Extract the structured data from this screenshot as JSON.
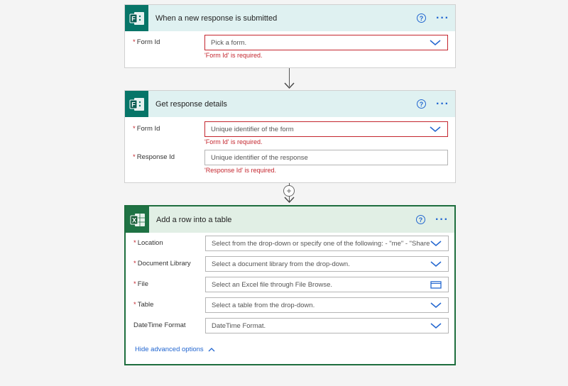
{
  "card1": {
    "title": "When a new response is submitted",
    "fields": [
      {
        "label": "Form Id",
        "required": true,
        "placeholder": "Pick a form.",
        "error": "'Form Id' is required."
      }
    ]
  },
  "card2": {
    "title": "Get response details",
    "fields": [
      {
        "label": "Form Id",
        "required": true,
        "placeholder": "Unique identifier of the form",
        "error": "'Form Id' is required."
      },
      {
        "label": "Response Id",
        "required": true,
        "placeholder": "Unique identifier of the response",
        "error": "'Response Id' is required."
      }
    ]
  },
  "card3": {
    "title": "Add a row into a table",
    "fields": [
      {
        "label": "Location",
        "required": true,
        "placeholder": "Select from the drop-down or specify one of the following: - \"me\" - \"SharePoint Site URL\""
      },
      {
        "label": "Document Library",
        "required": true,
        "placeholder": "Select a document library from the drop-down."
      },
      {
        "label": "File",
        "required": true,
        "placeholder": "Select an Excel file through File Browse."
      },
      {
        "label": "Table",
        "required": true,
        "placeholder": "Select a table from the drop-down."
      },
      {
        "label": "DateTime Format",
        "required": false,
        "placeholder": "DateTime Format."
      }
    ],
    "advanced_link": "Hide advanced options"
  },
  "required_mark": "*",
  "help_glyph": "?",
  "more_glyph": "···",
  "colors": {
    "forms_brand": "#077568",
    "excel_brand": "#1f7244",
    "link": "#2266d0",
    "error": "#c4262e"
  }
}
